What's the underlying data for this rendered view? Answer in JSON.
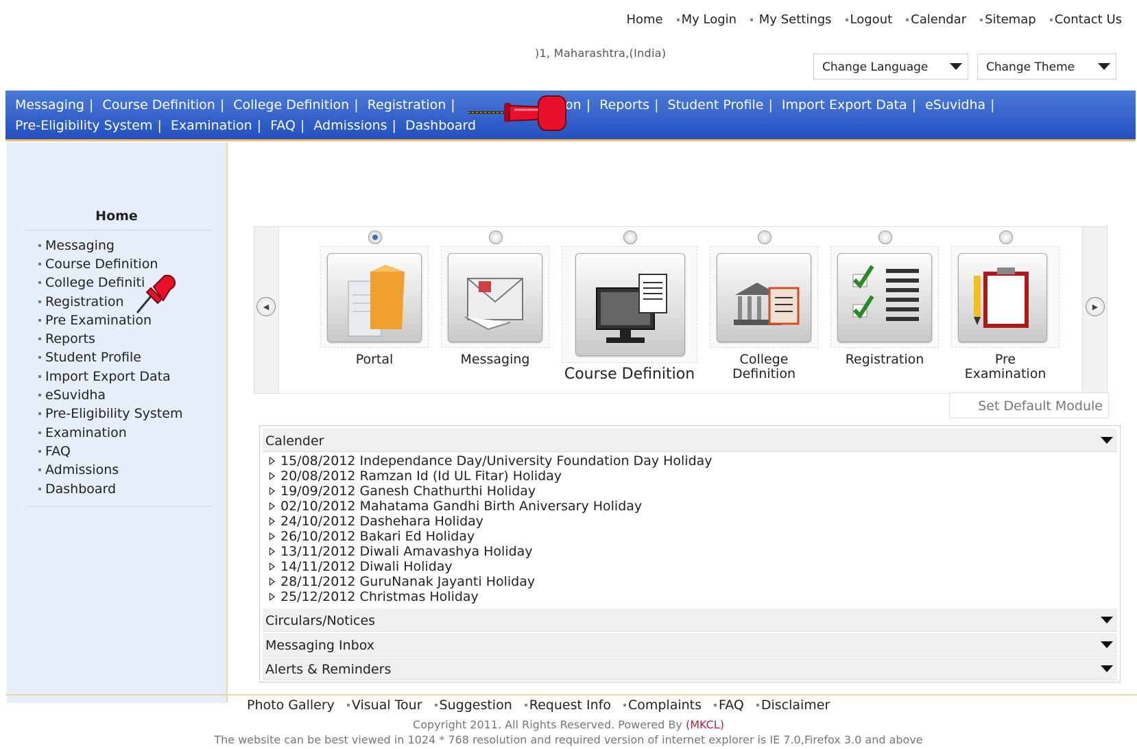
{
  "header": {
    "top_links": [
      "Home",
      "My Login",
      "My Settings",
      "Logout",
      "Calendar",
      "Sitemap",
      "Contact Us"
    ],
    "address": ")1, Maharashtra,(India)",
    "change_language": "Change Language",
    "change_theme": "Change Theme"
  },
  "navbar": {
    "row1": [
      "Messaging",
      "Course Definition",
      "College Definition",
      "Registration",
      "",
      "ation",
      "Reports",
      "Student Profile",
      "Import Export Data",
      "eSuvidha",
      ""
    ],
    "row2": [
      "Pre-Eligibility System",
      "Examination",
      "FAQ",
      "Admissions",
      "Dashboard"
    ]
  },
  "sidebar": {
    "title": "Home",
    "items": [
      "Messaging",
      "Course Definition",
      "College Definiti",
      "Registration",
      "Pre Examination",
      "Reports",
      "Student Profile",
      "Import Export Data",
      "eSuvidha",
      "Pre-Eligibility System",
      "Examination",
      "FAQ",
      "Admissions",
      "Dashboard"
    ]
  },
  "modules": {
    "portal": "Portal",
    "messaging": "Messaging",
    "course_definition": "Course Definition",
    "college_definition_1": "College",
    "college_definition_2": "Definition",
    "registration": "Registration",
    "pre_examination_1": "Pre",
    "pre_examination_2": "Examination",
    "set_default": "Set Default Module"
  },
  "accordion": {
    "calender": "Calender",
    "circulars": "Circulars/Notices",
    "inbox": "Messaging Inbox",
    "alerts": "Alerts & Reminders",
    "holidays": [
      "15/08/2012 Independance Day/University Foundation Day Holiday",
      "20/08/2012 Ramzan Id (Id UL Fitar) Holiday",
      "19/09/2012 Ganesh Chathurthi Holiday",
      "02/10/2012 Mahatama Gandhi Birth Aniversary Holiday",
      "24/10/2012 Dashehara Holiday",
      "26/10/2012 Bakari Ed Holiday",
      "13/11/2012 Diwali Amavashya Holiday",
      "14/11/2012 Diwali Holiday",
      "28/11/2012 GuruNanak Jayanti Holiday",
      "25/12/2012 Christmas Holiday"
    ]
  },
  "footer": {
    "links": [
      "Photo Gallery",
      "Visual Tour",
      "Suggestion",
      "Request Info",
      "Complaints",
      "FAQ",
      "Disclaimer"
    ],
    "copyright": "Copyright 2011. All Rights Reserved. Powered By",
    "mkcl": "(MKCL)",
    "best_view": "The website can be best viewed in 1024 * 768 resolution and required version of internet explorer is IE 7.0,Firefox 3.0 and above"
  },
  "colors": {
    "nav_blue": "#3564cc",
    "sidebar_bg": "#e6eefa",
    "pin_red": "#e8102a",
    "mkcl_red": "#c0203a"
  }
}
